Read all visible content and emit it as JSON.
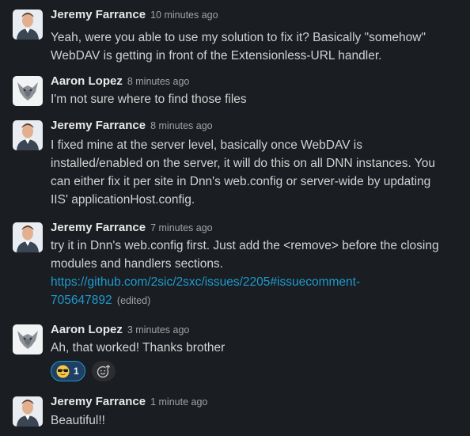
{
  "messages": [
    {
      "author": "Jeremy Farrance",
      "time": "10 minutes ago",
      "lines": [
        "Yeah, were you able to use my solution to fix it? Basically \"somehow\"",
        "WebDAV is getting in front of the Extensionless-URL handler."
      ]
    },
    {
      "author": "Aaron Lopez",
      "time": "8 minutes ago",
      "lines": [
        "I'm not sure where to find those files"
      ]
    },
    {
      "author": "Jeremy Farrance",
      "time": "8 minutes ago",
      "lines": [
        "I fixed mine at the server level, basically once WebDAV is",
        "installed/enabled on the server, it will do this on all DNN instances. You",
        "can either fix it per site in Dnn's web.config or server-wide by updating",
        "IIS' applicationHost.config."
      ]
    },
    {
      "author": "Jeremy Farrance",
      "time": "7 minutes ago",
      "lines": [
        "try it in Dnn's web.config first. Just add the <remove> before the closing",
        "modules and handlers sections."
      ],
      "link_line1": "https://github.com/2sic/2sxc/issues/2205#issuecomment-",
      "link_line2": "705647892",
      "edited": "(edited)"
    },
    {
      "author": "Aaron Lopez",
      "time": "3 minutes ago",
      "lines": [
        "Ah, that worked! Thanks brother"
      ],
      "reaction": {
        "emoji": "sunglasses-emoji",
        "count": "1"
      }
    },
    {
      "author": "Jeremy Farrance",
      "time": "1 minute ago",
      "lines": [
        "Beautiful!!"
      ]
    }
  ],
  "colors": {
    "background": "#1a1d21",
    "text": "#d1d2d3",
    "link": "#1d9bd1",
    "timestamp": "#a2a3a5",
    "reaction_bg": "#1f3f63"
  },
  "icons": {
    "add_reaction": "add-reaction-icon"
  }
}
